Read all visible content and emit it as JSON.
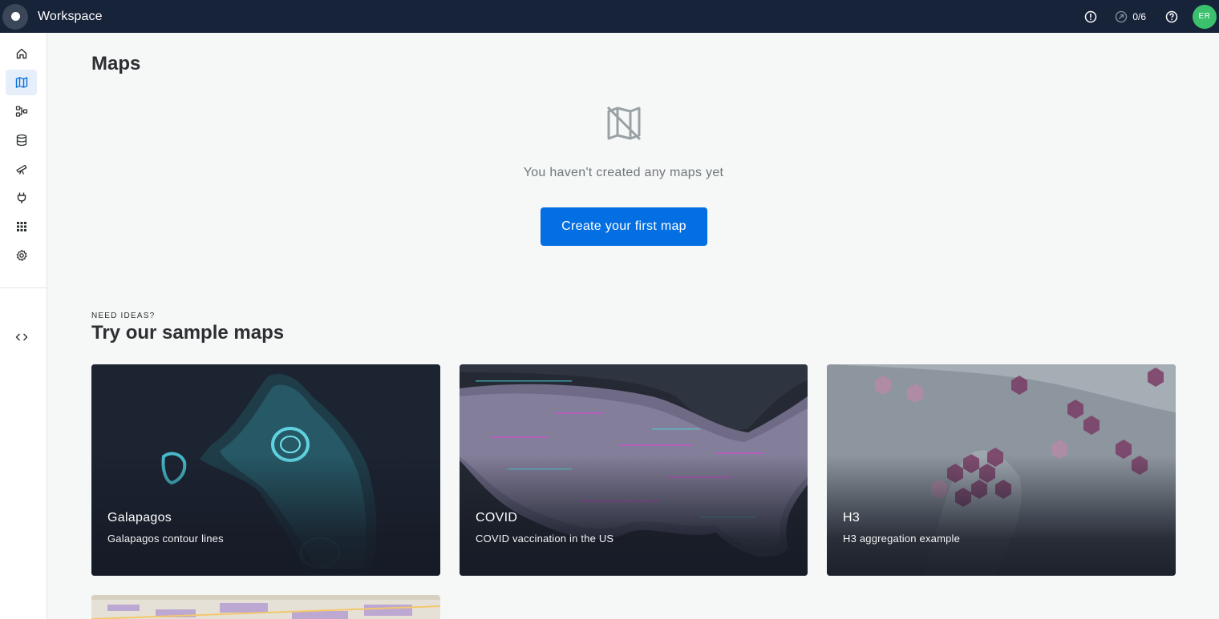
{
  "app": {
    "title": "Workspace"
  },
  "topbar": {
    "counter": "0/6",
    "avatar_initials": "ER",
    "icons": [
      "alert-icon",
      "progress-icon",
      "help-icon"
    ]
  },
  "sidebar": {
    "items": [
      {
        "name": "home",
        "icon": "home-icon",
        "active": false
      },
      {
        "name": "maps",
        "icon": "map-icon",
        "active": true
      },
      {
        "name": "workflows",
        "icon": "workflow-icon",
        "active": false
      },
      {
        "name": "data",
        "icon": "database-icon",
        "active": false
      },
      {
        "name": "data-observatory",
        "icon": "telescope-icon",
        "active": false
      },
      {
        "name": "connections",
        "icon": "plug-icon",
        "active": false
      },
      {
        "name": "apps",
        "icon": "apps-grid-icon",
        "active": false
      },
      {
        "name": "settings",
        "icon": "gear-icon",
        "active": false
      },
      {
        "name": "developers",
        "icon": "code-icon",
        "active": false
      }
    ]
  },
  "main": {
    "title": "Maps",
    "empty_state": {
      "icon": "no-map-icon",
      "message": "You haven't created any maps yet",
      "cta_label": "Create your first map"
    },
    "samples": {
      "overline": "NEED IDEAS?",
      "title": "Try our sample maps",
      "cards": [
        {
          "title": "Galapagos",
          "subtitle": "Galapagos contour lines"
        },
        {
          "title": "COVID",
          "subtitle": "COVID vaccination in the US"
        },
        {
          "title": "H3",
          "subtitle": "H3 aggregation example"
        },
        {
          "title": "",
          "subtitle": ""
        }
      ]
    }
  },
  "colors": {
    "topbar": "#162339",
    "primary": "#036fe2",
    "avatar": "#3bc16e",
    "sidebar_active": "#e6eef9",
    "background": "#f6f7f7"
  }
}
